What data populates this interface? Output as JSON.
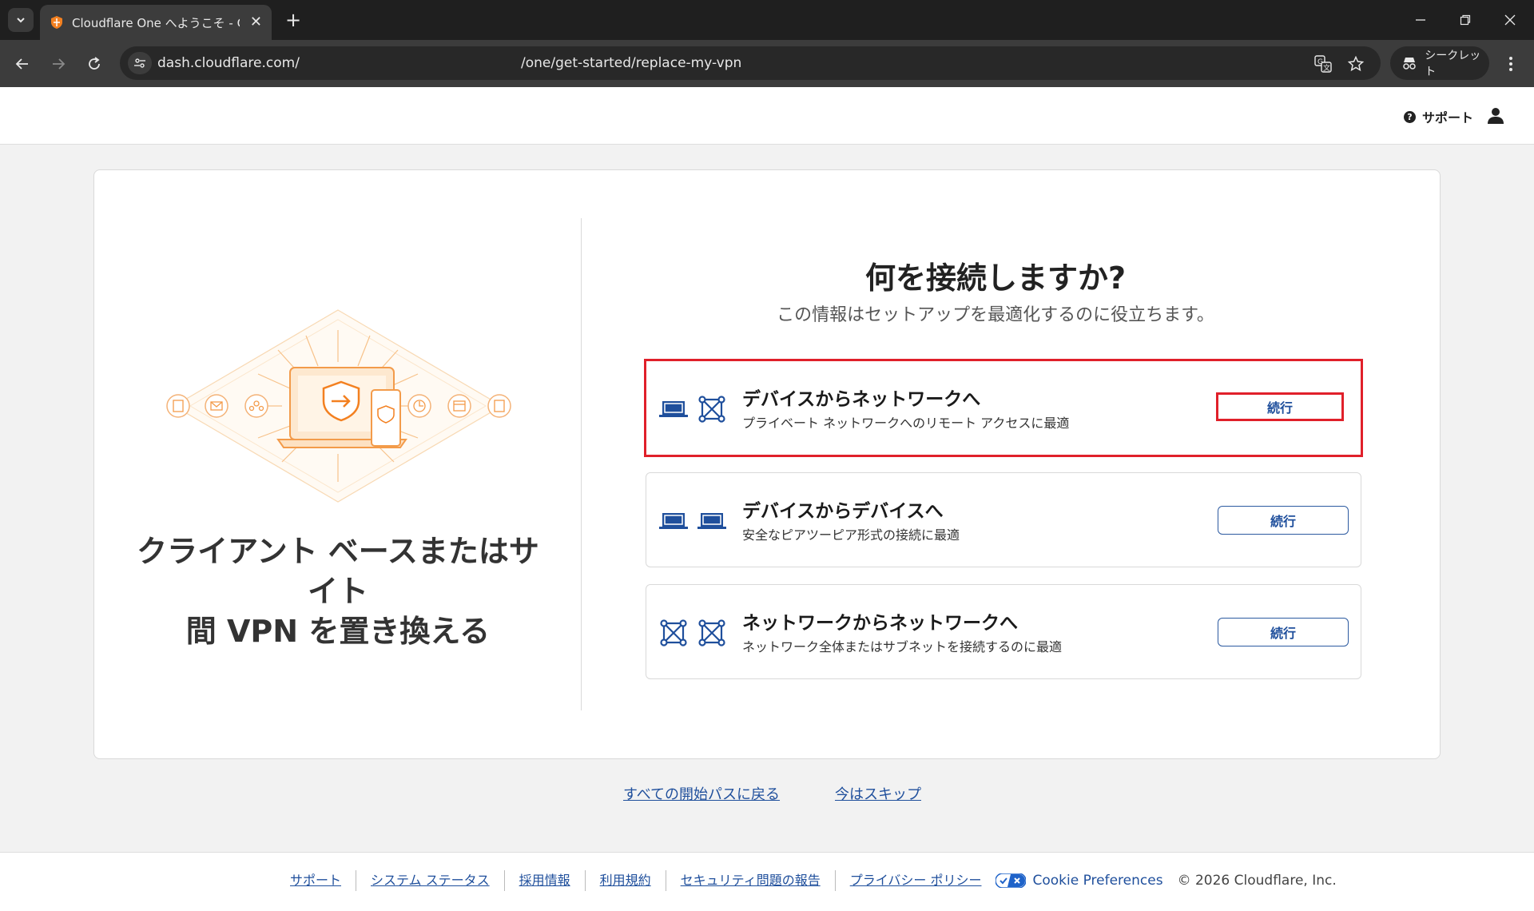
{
  "browser": {
    "tab_title": "Cloudflare One へようこそ - Clouc",
    "url_host": "dash.cloudflare.com/",
    "url_path": "/one/get-started/replace-my-vpn",
    "incognito_label": "シークレット"
  },
  "header": {
    "support_label": "サポート"
  },
  "left_panel": {
    "title_line1": "クライアント ベースまたはサイト",
    "title_line2": "間 VPN を置き換える"
  },
  "main": {
    "question": "何を接続しますか?",
    "subtitle": "この情報はセットアップを最適化するのに役立ちます。",
    "options": [
      {
        "title": "デバイスからネットワークへ",
        "desc": "プライベート ネットワークへのリモート アクセスに最適",
        "button": "続行",
        "icons": [
          "laptop-icon",
          "network-icon"
        ]
      },
      {
        "title": "デバイスからデバイスへ",
        "desc": "安全なピアツーピア形式の接続に最適",
        "button": "続行",
        "icons": [
          "laptop-icon",
          "laptop-icon"
        ]
      },
      {
        "title": "ネットワークからネットワークへ",
        "desc": "ネットワーク全体またはサブネットを接続するのに最適",
        "button": "続行",
        "icons": [
          "network-icon",
          "network-icon"
        ]
      }
    ]
  },
  "links": {
    "back_all": "すべての開始パスに戻る",
    "skip": "今はスキップ"
  },
  "footer": {
    "links": [
      "サポート",
      "システム ステータス",
      "採用情報",
      "利用規約",
      "セキュリティ問題の報告",
      "プライバシー ポリシー"
    ],
    "cookie_label": "Cookie Preferences",
    "copyright": "© 2026 Cloudflare, Inc."
  },
  "colors": {
    "accent": "#1f4f9c",
    "highlight": "#e0202a",
    "brand_orange": "#f38020"
  }
}
